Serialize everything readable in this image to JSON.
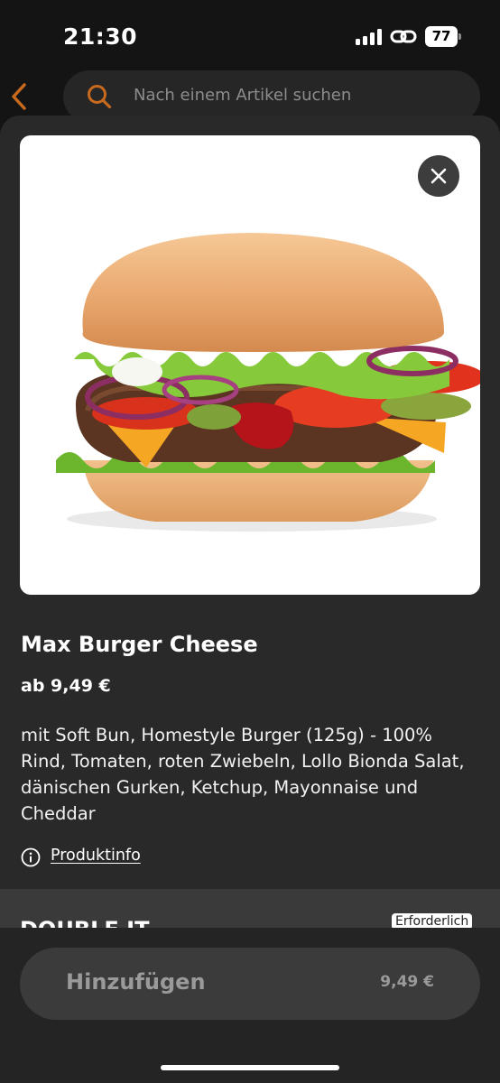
{
  "status_bar": {
    "time": "21:30",
    "battery": "77"
  },
  "search": {
    "placeholder": "Nach einem Artikel suchen"
  },
  "product": {
    "title": "Max Burger Cheese",
    "price": "ab 9,49 €",
    "description": "mit Soft Bun, Homestyle Burger (125g) - 100% Rind, Tomaten, roten Zwiebeln, Lollo Bionda Salat, dänischen Gurken, Ketchup, Mayonnaise und Cheddar",
    "info_link": "Produktinfo"
  },
  "option_group": {
    "title": "DOUBLE IT",
    "badge": "Erforderlich"
  },
  "footer": {
    "add_label": "Hinzufügen",
    "add_price": "9,49 €"
  },
  "colors": {
    "accent": "#c86a1e",
    "sheet": "#292929",
    "background": "#141414"
  }
}
